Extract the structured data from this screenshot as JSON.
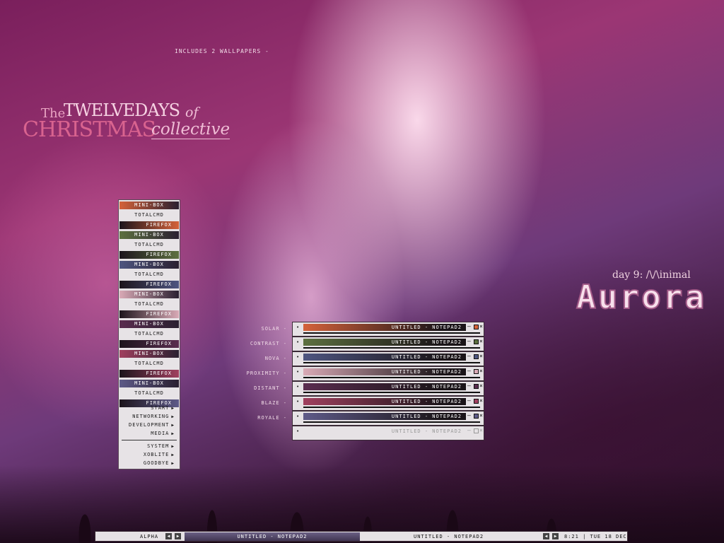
{
  "notice": "INCLUDES 2 WALLPAPERS -",
  "logo": {
    "the": "The",
    "twelvedays": "TWELVEDAYS",
    "of": "of",
    "christmas": "CHRISTMAS",
    "collective": "collective"
  },
  "title": {
    "day": "day 9: /\\/\\inimal",
    "name": "Aurora"
  },
  "menu": {
    "groups": [
      {
        "minibox": "MINI-BOX",
        "totalcmd": "TOTALCMD",
        "firefox": "FIREFOX",
        "accent": "#d4623a"
      },
      {
        "minibox": "MINI-BOX",
        "totalcmd": "TOTALCMD",
        "firefox": "FIREFOX",
        "accent": "#5d7040"
      },
      {
        "minibox": "MINI-BOX",
        "totalcmd": "TOTALCMD",
        "firefox": "FIREFOX",
        "accent": "#4e5580"
      },
      {
        "minibox": "MINI-BOX",
        "totalcmd": "TOTALCMD",
        "firefox": "FIREFOX",
        "accent": "#d9aab6"
      },
      {
        "minibox": "MINI-BOX",
        "totalcmd": "TOTALCMD",
        "firefox": "FIREFOX",
        "accent": "#5a2c4f"
      },
      {
        "minibox": "MINI-BOX",
        "totalcmd": "TOTALCMD",
        "firefox": "FIREFOX",
        "accent": "#a0405f"
      },
      {
        "minibox": "MINI-BOX",
        "totalcmd": "TOTALCMD",
        "firefox": "FIREFOX",
        "accent": "#5e5a88"
      }
    ],
    "nav": [
      "START",
      "NETWORKING",
      "DEVELOPMENT",
      "MEDIA",
      "SYSTEM",
      "XOBLITE",
      "GOODBYE"
    ]
  },
  "themes": [
    {
      "label": "SOLAR -",
      "accent": "#d4623a"
    },
    {
      "label": "CONTRAST -",
      "accent": "#5d7040"
    },
    {
      "label": "NOVA -",
      "accent": "#4e5580"
    },
    {
      "label": "PROXIMITY -",
      "accent": "#d9aab6"
    },
    {
      "label": "DISTANT -",
      "accent": "#5a2c4f"
    },
    {
      "label": "BLAZE -",
      "accent": "#a0405f"
    },
    {
      "label": "ROYALE -",
      "accent": "#5e5a88"
    },
    {
      "label": "",
      "accent": "#e6e2e5"
    }
  ],
  "window_title": "UNTITLED - NOTEPAD2",
  "taskbar": {
    "workspace": "ALPHA",
    "active_task": "UNTITLED - NOTEPAD2",
    "inactive_task": "UNTITLED - NOTEPAD2",
    "clock": "8:21 | TUE 18 DEC"
  }
}
